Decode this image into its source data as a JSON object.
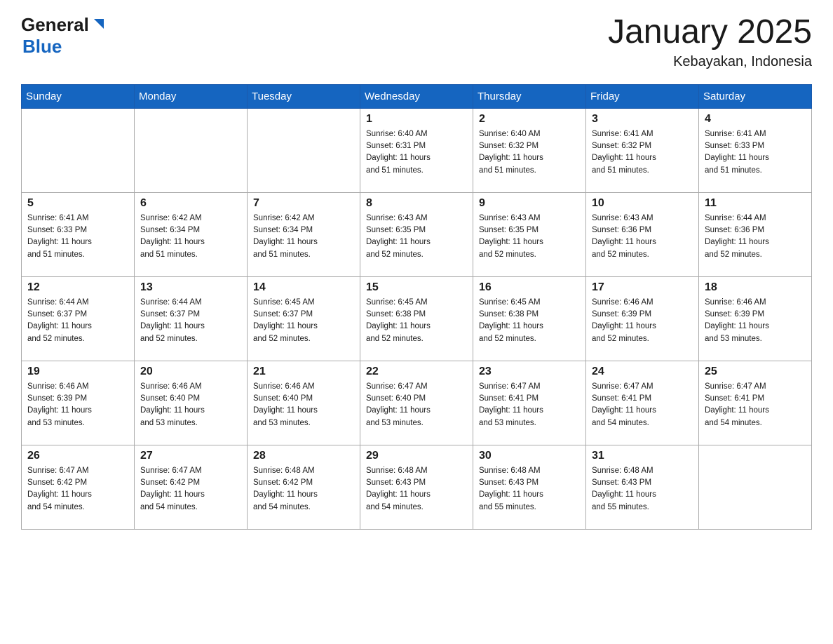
{
  "header": {
    "logo_general": "General",
    "logo_blue": "Blue",
    "month_title": "January 2025",
    "location": "Kebayakan, Indonesia"
  },
  "calendar": {
    "days_of_week": [
      "Sunday",
      "Monday",
      "Tuesday",
      "Wednesday",
      "Thursday",
      "Friday",
      "Saturday"
    ],
    "weeks": [
      [
        {
          "day": "",
          "info": ""
        },
        {
          "day": "",
          "info": ""
        },
        {
          "day": "",
          "info": ""
        },
        {
          "day": "1",
          "info": "Sunrise: 6:40 AM\nSunset: 6:31 PM\nDaylight: 11 hours\nand 51 minutes."
        },
        {
          "day": "2",
          "info": "Sunrise: 6:40 AM\nSunset: 6:32 PM\nDaylight: 11 hours\nand 51 minutes."
        },
        {
          "day": "3",
          "info": "Sunrise: 6:41 AM\nSunset: 6:32 PM\nDaylight: 11 hours\nand 51 minutes."
        },
        {
          "day": "4",
          "info": "Sunrise: 6:41 AM\nSunset: 6:33 PM\nDaylight: 11 hours\nand 51 minutes."
        }
      ],
      [
        {
          "day": "5",
          "info": "Sunrise: 6:41 AM\nSunset: 6:33 PM\nDaylight: 11 hours\nand 51 minutes."
        },
        {
          "day": "6",
          "info": "Sunrise: 6:42 AM\nSunset: 6:34 PM\nDaylight: 11 hours\nand 51 minutes."
        },
        {
          "day": "7",
          "info": "Sunrise: 6:42 AM\nSunset: 6:34 PM\nDaylight: 11 hours\nand 51 minutes."
        },
        {
          "day": "8",
          "info": "Sunrise: 6:43 AM\nSunset: 6:35 PM\nDaylight: 11 hours\nand 52 minutes."
        },
        {
          "day": "9",
          "info": "Sunrise: 6:43 AM\nSunset: 6:35 PM\nDaylight: 11 hours\nand 52 minutes."
        },
        {
          "day": "10",
          "info": "Sunrise: 6:43 AM\nSunset: 6:36 PM\nDaylight: 11 hours\nand 52 minutes."
        },
        {
          "day": "11",
          "info": "Sunrise: 6:44 AM\nSunset: 6:36 PM\nDaylight: 11 hours\nand 52 minutes."
        }
      ],
      [
        {
          "day": "12",
          "info": "Sunrise: 6:44 AM\nSunset: 6:37 PM\nDaylight: 11 hours\nand 52 minutes."
        },
        {
          "day": "13",
          "info": "Sunrise: 6:44 AM\nSunset: 6:37 PM\nDaylight: 11 hours\nand 52 minutes."
        },
        {
          "day": "14",
          "info": "Sunrise: 6:45 AM\nSunset: 6:37 PM\nDaylight: 11 hours\nand 52 minutes."
        },
        {
          "day": "15",
          "info": "Sunrise: 6:45 AM\nSunset: 6:38 PM\nDaylight: 11 hours\nand 52 minutes."
        },
        {
          "day": "16",
          "info": "Sunrise: 6:45 AM\nSunset: 6:38 PM\nDaylight: 11 hours\nand 52 minutes."
        },
        {
          "day": "17",
          "info": "Sunrise: 6:46 AM\nSunset: 6:39 PM\nDaylight: 11 hours\nand 52 minutes."
        },
        {
          "day": "18",
          "info": "Sunrise: 6:46 AM\nSunset: 6:39 PM\nDaylight: 11 hours\nand 53 minutes."
        }
      ],
      [
        {
          "day": "19",
          "info": "Sunrise: 6:46 AM\nSunset: 6:39 PM\nDaylight: 11 hours\nand 53 minutes."
        },
        {
          "day": "20",
          "info": "Sunrise: 6:46 AM\nSunset: 6:40 PM\nDaylight: 11 hours\nand 53 minutes."
        },
        {
          "day": "21",
          "info": "Sunrise: 6:46 AM\nSunset: 6:40 PM\nDaylight: 11 hours\nand 53 minutes."
        },
        {
          "day": "22",
          "info": "Sunrise: 6:47 AM\nSunset: 6:40 PM\nDaylight: 11 hours\nand 53 minutes."
        },
        {
          "day": "23",
          "info": "Sunrise: 6:47 AM\nSunset: 6:41 PM\nDaylight: 11 hours\nand 53 minutes."
        },
        {
          "day": "24",
          "info": "Sunrise: 6:47 AM\nSunset: 6:41 PM\nDaylight: 11 hours\nand 54 minutes."
        },
        {
          "day": "25",
          "info": "Sunrise: 6:47 AM\nSunset: 6:41 PM\nDaylight: 11 hours\nand 54 minutes."
        }
      ],
      [
        {
          "day": "26",
          "info": "Sunrise: 6:47 AM\nSunset: 6:42 PM\nDaylight: 11 hours\nand 54 minutes."
        },
        {
          "day": "27",
          "info": "Sunrise: 6:47 AM\nSunset: 6:42 PM\nDaylight: 11 hours\nand 54 minutes."
        },
        {
          "day": "28",
          "info": "Sunrise: 6:48 AM\nSunset: 6:42 PM\nDaylight: 11 hours\nand 54 minutes."
        },
        {
          "day": "29",
          "info": "Sunrise: 6:48 AM\nSunset: 6:43 PM\nDaylight: 11 hours\nand 54 minutes."
        },
        {
          "day": "30",
          "info": "Sunrise: 6:48 AM\nSunset: 6:43 PM\nDaylight: 11 hours\nand 55 minutes."
        },
        {
          "day": "31",
          "info": "Sunrise: 6:48 AM\nSunset: 6:43 PM\nDaylight: 11 hours\nand 55 minutes."
        },
        {
          "day": "",
          "info": ""
        }
      ]
    ]
  }
}
